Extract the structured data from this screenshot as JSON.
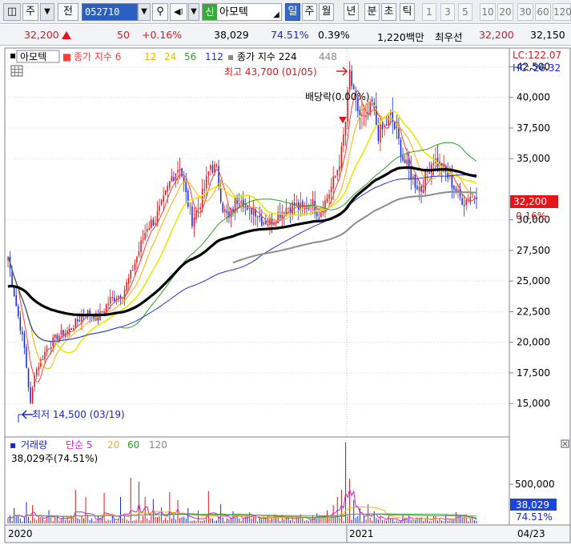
{
  "toolbar": {
    "stock_code": "052710",
    "market_badge": "신",
    "stock_name": "아모텍",
    "btn_ju": "주",
    "btn_jeon": "전",
    "periods": [
      {
        "label": "일",
        "selected": true
      },
      {
        "label": "주",
        "selected": false
      },
      {
        "label": "월",
        "selected": false
      },
      {
        "label": "년",
        "selected": false
      },
      {
        "label": "분",
        "selected": false
      },
      {
        "label": "초",
        "selected": false
      },
      {
        "label": "틱",
        "selected": false
      }
    ],
    "intervals": [
      "1",
      "3",
      "5",
      "10",
      "20",
      "30",
      "60",
      "120"
    ]
  },
  "quote": {
    "price": "32,200",
    "change": "50",
    "change_pct": "+0.16%",
    "volume": "38,029",
    "volume_ratio": "74.51%",
    "turnover_pct": "0.39%",
    "trade_value": "1,220백만",
    "best_bid_label": "최우선",
    "best_bid": "32,200",
    "best_ask": "32,150"
  },
  "colors": {
    "up": "#e0161b",
    "down": "#1427d8",
    "ma6": "#ff3b3b",
    "ma12": "#ffae00",
    "ma24": "#e8e800",
    "ma56": "#2aa02a",
    "ma112": "#2335d5",
    "ma224": "#000000",
    "ma448": "#8c8c8c"
  },
  "chart_data": {
    "type": "line",
    "title": "아모텍",
    "x_start_label": "2020",
    "x_mid_label": "2021",
    "x_end_label": "04/23",
    "legend_price": [
      "종가 지수 6",
      "12",
      "24",
      "56",
      "112"
    ],
    "legend_price_long": [
      "종가 지수 224",
      "448"
    ],
    "yticks": [
      "42,500",
      "40,000",
      "37,500",
      "35,000",
      "32,200",
      "30,000",
      "27,500",
      "25,000",
      "22,500",
      "20,000",
      "17,500",
      "15,000"
    ],
    "ylim": [
      12400,
      43900
    ],
    "last_price_label": "32,200",
    "last_change_label": "0.16%",
    "lc_label": "LC:122.07",
    "hc_label": "HC:-26.32",
    "high_annotation": "최고 43,700 (01/05)",
    "low_annotation": "최저 14,500 (03/19)",
    "dividend_annotation": "배당락(0.00%)",
    "close_anchors": [
      [
        0,
        27000
      ],
      [
        4,
        23000
      ],
      [
        8,
        19500
      ],
      [
        11,
        14900
      ],
      [
        13,
        17500
      ],
      [
        16,
        18500
      ],
      [
        19,
        19500
      ],
      [
        24,
        20500
      ],
      [
        30,
        21000
      ],
      [
        38,
        22500
      ],
      [
        44,
        22000
      ],
      [
        50,
        23500
      ],
      [
        56,
        24000
      ],
      [
        60,
        25500
      ],
      [
        64,
        27500
      ],
      [
        68,
        29500
      ],
      [
        72,
        30000
      ],
      [
        76,
        31500
      ],
      [
        80,
        33500
      ],
      [
        84,
        34500
      ],
      [
        87,
        32000
      ],
      [
        90,
        30000
      ],
      [
        93,
        31000
      ],
      [
        96,
        32500
      ],
      [
        99,
        34500
      ],
      [
        102,
        34000
      ],
      [
        105,
        31000
      ],
      [
        108,
        30000
      ],
      [
        111,
        31500
      ],
      [
        114,
        32000
      ],
      [
        117,
        30500
      ],
      [
        120,
        31000
      ],
      [
        124,
        30000
      ],
      [
        128,
        29800
      ],
      [
        132,
        30500
      ],
      [
        136,
        31000
      ],
      [
        140,
        31200
      ],
      [
        144,
        30800
      ],
      [
        148,
        31500
      ],
      [
        152,
        30500
      ],
      [
        156,
        31800
      ],
      [
        160,
        33500
      ],
      [
        163,
        35500
      ],
      [
        165,
        38000
      ],
      [
        167,
        42000
      ],
      [
        169,
        40000
      ],
      [
        172,
        38500
      ],
      [
        175,
        38000
      ],
      [
        178,
        39500
      ],
      [
        181,
        37000
      ],
      [
        184,
        37500
      ],
      [
        187,
        38500
      ],
      [
        190,
        37000
      ],
      [
        193,
        35000
      ],
      [
        196,
        34000
      ],
      [
        199,
        33000
      ],
      [
        202,
        32500
      ],
      [
        205,
        34000
      ],
      [
        208,
        35000
      ],
      [
        211,
        34500
      ],
      [
        214,
        33800
      ],
      [
        217,
        33000
      ],
      [
        220,
        32000
      ],
      [
        223,
        31500
      ],
      [
        226,
        32000
      ],
      [
        229,
        32200
      ]
    ],
    "volume": {
      "legend": [
        "거래량",
        "단순 5",
        "20",
        "60",
        "120"
      ],
      "current_label": "38,029주(74.51%)",
      "axis_tick": "500,000",
      "last_volume_label": "38,029",
      "last_ratio_label": "74.51%",
      "ylim": [
        0,
        820000
      ],
      "typical": 45000,
      "spikes": [
        [
          3,
          150000
        ],
        [
          9,
          210000
        ],
        [
          12,
          180000
        ],
        [
          20,
          130000
        ],
        [
          33,
          330000
        ],
        [
          38,
          260000
        ],
        [
          47,
          300000
        ],
        [
          55,
          260000
        ],
        [
          60,
          450000
        ],
        [
          64,
          410000
        ],
        [
          67,
          260000
        ],
        [
          71,
          240000
        ],
        [
          75,
          160000
        ],
        [
          79,
          310000
        ],
        [
          83,
          230000
        ],
        [
          88,
          150000
        ],
        [
          93,
          130000
        ],
        [
          98,
          320000
        ],
        [
          104,
          190000
        ],
        [
          110,
          120000
        ],
        [
          118,
          110000
        ],
        [
          130,
          90000
        ],
        [
          143,
          90000
        ],
        [
          151,
          100000
        ],
        [
          156,
          130000
        ],
        [
          159,
          180000
        ],
        [
          161,
          260000
        ],
        [
          163,
          330000
        ],
        [
          165,
          800000
        ],
        [
          167,
          440000
        ],
        [
          169,
          230000
        ],
        [
          172,
          150000
        ],
        [
          176,
          190000
        ],
        [
          179,
          120000
        ],
        [
          186,
          95000
        ],
        [
          196,
          80000
        ],
        [
          205,
          70000
        ],
        [
          214,
          85000
        ],
        [
          219,
          110000
        ],
        [
          224,
          90000
        ]
      ]
    }
  }
}
